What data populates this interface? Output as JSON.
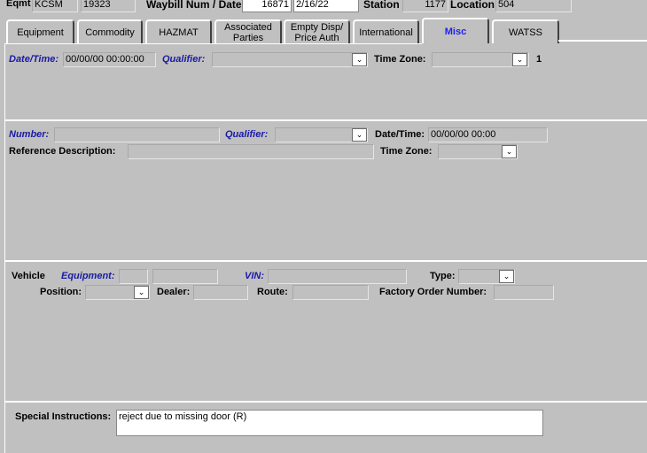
{
  "header": {
    "eqmt_label": "Eqmt",
    "eqmt_initial": "KCSM",
    "eqmt_number": "19323",
    "waybill_label": "Waybill Num / Date",
    "waybill_num": "16871",
    "waybill_date": "2/16/22",
    "station_label": "Station",
    "station_value": "1177",
    "location_label": "Location",
    "location_value": "504"
  },
  "tabs": [
    {
      "label": "Equipment"
    },
    {
      "label": "Commodity"
    },
    {
      "label": "HAZMAT"
    },
    {
      "label": "Associated\nParties"
    },
    {
      "label": "Empty Disp/\nPrice Auth"
    },
    {
      "label": "International"
    },
    {
      "label": "Misc"
    },
    {
      "label": "WATSS"
    }
  ],
  "section1": {
    "datetime_label": "Date/Time:",
    "datetime_value": "00/00/00 00:00:00",
    "qualifier_label": "Qualifier:",
    "qualifier_value": "",
    "timezone_label": "Time Zone:",
    "timezone_value": "",
    "counter": "1"
  },
  "section2": {
    "number_label": "Number:",
    "number_value": "",
    "qualifier_label": "Qualifier:",
    "qualifier_value": "",
    "datetime_label": "Date/Time:",
    "datetime_value": "00/00/00 00:00",
    "refdesc_label": "Reference Description:",
    "refdesc_value": "",
    "timezone_label": "Time Zone:",
    "timezone_value": ""
  },
  "section3": {
    "vehicle_label": "Vehicle",
    "equipment_label": "Equipment:",
    "vin_label": "VIN:",
    "type_label": "Type:",
    "position_label": "Position:",
    "dealer_label": "Dealer:",
    "route_label": "Route:",
    "factory_label": "Factory Order Number:"
  },
  "section4": {
    "special_label": "Special Instructions:",
    "special_value": "reject due to missing door (R)"
  },
  "icons": {
    "dropdown": "chevron-down-icon"
  }
}
